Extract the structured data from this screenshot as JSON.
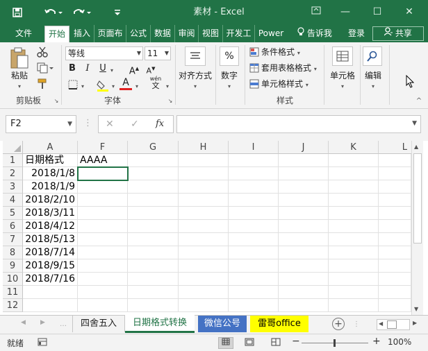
{
  "titlebar": {
    "title": "素材 - Excel",
    "save_icon": "save-icon",
    "minimize": "—",
    "restore": "☐",
    "close": "✕"
  },
  "tabs": [
    {
      "label": "文件"
    },
    {
      "label": "开始"
    },
    {
      "label": "插入"
    },
    {
      "label": "页面布"
    },
    {
      "label": "公式"
    },
    {
      "label": "数据"
    },
    {
      "label": "审阅"
    },
    {
      "label": "视图"
    },
    {
      "label": "开发工"
    },
    {
      "label": "Power"
    }
  ],
  "tell_me": "告诉我",
  "login": "登录",
  "share": "共享",
  "ribbon": {
    "paste": "粘贴",
    "clipboard": "剪贴板",
    "font_name": "等线",
    "font_size": "11",
    "font_group": "字体",
    "align": "对齐方式",
    "number": "数字",
    "cond_format": "条件格式",
    "table_format": "套用表格格式",
    "cell_style": "单元格样式",
    "styles_group": "样式",
    "cells": "单元格",
    "editing": "编辑",
    "bold": "B",
    "italic": "I",
    "underline": "U",
    "grow": "A",
    "shrink": "A",
    "fill_letter": "A",
    "wen": "wén",
    "wen_char": "文",
    "percent": "%"
  },
  "formula_bar": {
    "name_box": "F2",
    "fx": "fx",
    "cancel": "✕",
    "enter": "✓",
    "formula": ""
  },
  "columns": [
    "A",
    "F",
    "G",
    "H",
    "I",
    "J",
    "K",
    "L"
  ],
  "rows": [
    "1",
    "2",
    "3",
    "4",
    "5",
    "6",
    "7",
    "8",
    "9",
    "10",
    "11",
    "12"
  ],
  "cells": {
    "A": [
      "日期格式",
      "2018/1/8",
      "2018/1/9",
      "2018/2/10",
      "2018/3/11",
      "2018/4/12",
      "2018/5/13",
      "2018/7/14",
      "2018/9/15",
      "2018/7/16",
      "",
      ""
    ],
    "F": [
      "AAAA",
      "",
      "",
      "",
      "",
      "",
      "",
      "",
      "",
      "",
      "",
      ""
    ]
  },
  "sheets": [
    {
      "label": "四舍五入",
      "active": false
    },
    {
      "label": "日期格式转换",
      "active": true
    },
    {
      "label": "微信公号",
      "active": false,
      "bg": "#4472c4",
      "color": "#ffffff"
    },
    {
      "label": "雷哥office",
      "active": false,
      "bg": "#ffff00",
      "color": "#000000"
    }
  ],
  "status": {
    "ready": "就绪",
    "zoom": "100%",
    "minus": "−",
    "plus": "+"
  },
  "colors": {
    "excel_green": "#217346"
  }
}
